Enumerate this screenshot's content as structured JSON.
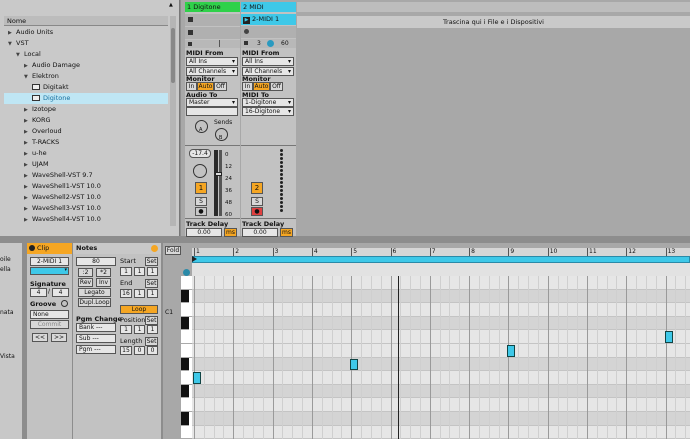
{
  "browser": {
    "header": "Nome",
    "items": [
      {
        "label": "Audio Units",
        "indent": 0,
        "expanded": false
      },
      {
        "label": "VST",
        "indent": 0,
        "expanded": true
      },
      {
        "label": "Local",
        "indent": 1,
        "expanded": true
      },
      {
        "label": "Audio Damage",
        "indent": 2,
        "expanded": false
      },
      {
        "label": "Elektron",
        "indent": 2,
        "expanded": true
      },
      {
        "label": "Digitakt",
        "indent": 3,
        "plugin": true
      },
      {
        "label": "Digitone",
        "indent": 3,
        "plugin": true,
        "selected": true
      },
      {
        "label": "Izotope",
        "indent": 2,
        "expanded": false
      },
      {
        "label": "KORG",
        "indent": 2,
        "expanded": false
      },
      {
        "label": "Overloud",
        "indent": 2,
        "expanded": false
      },
      {
        "label": "T-RACKS",
        "indent": 2,
        "expanded": false
      },
      {
        "label": "u-he",
        "indent": 2,
        "expanded": false
      },
      {
        "label": "UJAM",
        "indent": 2,
        "expanded": false
      },
      {
        "label": "WaveShell-VST 9.7",
        "indent": 2,
        "expanded": false
      },
      {
        "label": "WaveShell1-VST 10.0",
        "indent": 2,
        "expanded": false
      },
      {
        "label": "WaveShell2-VST 10.0",
        "indent": 2,
        "expanded": false
      },
      {
        "label": "WaveShell3-VST 10.0",
        "indent": 2,
        "expanded": false
      },
      {
        "label": "WaveShell4-VST 10.0",
        "indent": 2,
        "expanded": false
      }
    ]
  },
  "drop_hint": "Trascina qui i File e i Dispositivi",
  "tracks": [
    {
      "name": "1 Digitone",
      "color": "#2fd14a",
      "clip": "",
      "midi_from_label": "MIDI From",
      "midi_from": "All Ins",
      "channel": "All Channels",
      "monitor_label": "Monitor",
      "monitor": [
        "In",
        "Auto",
        "Off"
      ],
      "route_label": "Audio To",
      "route": "Master",
      "route2": "",
      "sends_label": "Sends",
      "sends": [
        "A",
        "B"
      ],
      "volume": "-17.4",
      "meter_scale": [
        "0",
        "12",
        "24",
        "36",
        "48",
        "60"
      ],
      "number": "1",
      "solo": "S",
      "delay_label": "Track Delay",
      "delay": "0.00",
      "delay_unit": "ms"
    },
    {
      "name": "2 MIDI",
      "color": "#3ec8e8",
      "clip": "2-MIDI 1",
      "midi_from_label": "MIDI From",
      "midi_from": "All Ins",
      "channel": "All Channels",
      "monitor_label": "Monitor",
      "monitor": [
        "In",
        "Auto",
        "Off"
      ],
      "route_label": "MIDI To",
      "route": "1-Digitone",
      "route2": "16-Digitone",
      "clip_vals": [
        "3",
        "60"
      ],
      "number": "2",
      "solo": "S",
      "delay_label": "Track Delay",
      "delay": "0.00",
      "delay_unit": "ms"
    }
  ],
  "left_strip_labels": [
    "oile",
    "ella",
    "nata",
    "Vista"
  ],
  "clip_panel": {
    "header": "Clip",
    "name": "2-MIDI 1",
    "signature_label": "Signature",
    "sig_num": "4",
    "sig_den": "4",
    "groove_label": "Groove",
    "groove": "None",
    "commit": "Commit",
    "nav": [
      "<<",
      ">>"
    ]
  },
  "notes_panel": {
    "header": "Notes",
    "value": "80",
    "btns": [
      ":2",
      "*2",
      "Rev",
      "Inv",
      "Legato",
      "Dupl.Loop"
    ],
    "start_label": "Start",
    "start": [
      "1",
      "1",
      "1"
    ],
    "end_label": "End",
    "end": [
      "16",
      "1",
      "1"
    ],
    "loop": "Loop",
    "position_label": "Position",
    "position": [
      "1",
      "1",
      "1"
    ],
    "length_label": "Length",
    "length": [
      "15",
      "0",
      "0"
    ],
    "pgm_label": "Pgm Change",
    "bank": "Bank ---",
    "sub": "Sub ---",
    "pgm": "Pgm ---",
    "set": "Set"
  },
  "piano_roll": {
    "fold": "Fold",
    "bars": [
      "1",
      "2",
      "3",
      "4",
      "5",
      "6",
      "7",
      "8",
      "9",
      "10",
      "11",
      "12",
      "13"
    ],
    "key_label": "C1",
    "notes": [
      {
        "bar": 1.0,
        "row": 7
      },
      {
        "bar": 5.0,
        "row": 6
      },
      {
        "bar": 9.0,
        "row": 5
      },
      {
        "bar": 13.0,
        "row": 4
      }
    ]
  }
}
